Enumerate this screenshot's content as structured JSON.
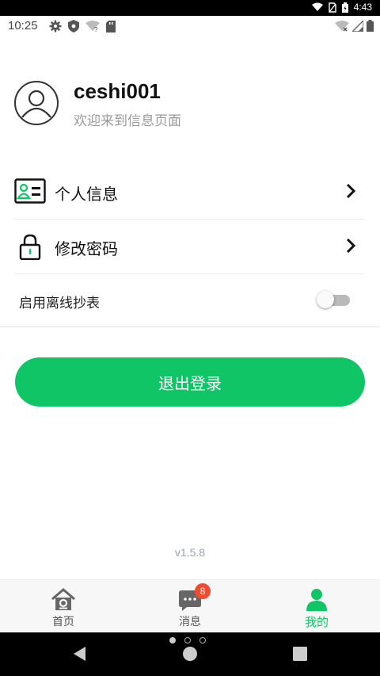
{
  "system": {
    "clock": "4:43",
    "status_time": "10:25"
  },
  "profile": {
    "username": "ceshi001",
    "welcome": "欢迎来到信息页面"
  },
  "menu": {
    "personal_info": "个人信息",
    "change_password": "修改密码",
    "offline_reading_label": "启用离线抄表",
    "offline_reading_enabled": false
  },
  "logout_label": "退出登录",
  "version": "v1.5.8",
  "tabs": {
    "home": "首页",
    "messages": "消息",
    "messages_badge": "8",
    "mine": "我的",
    "active": "mine"
  },
  "colors": {
    "accent": "#0fc566",
    "badge": "#f04b2f",
    "toggle_off": "#b9b9b9"
  },
  "icons": {
    "profile_avatar": "user-avatar-icon",
    "personal_info": "id-card-icon",
    "change_password": "padlock-icon",
    "row_arrow": "chevron-right-icon",
    "tab_home": "house-icon",
    "tab_messages": "chat-bubble-icon",
    "tab_mine": "person-icon"
  }
}
